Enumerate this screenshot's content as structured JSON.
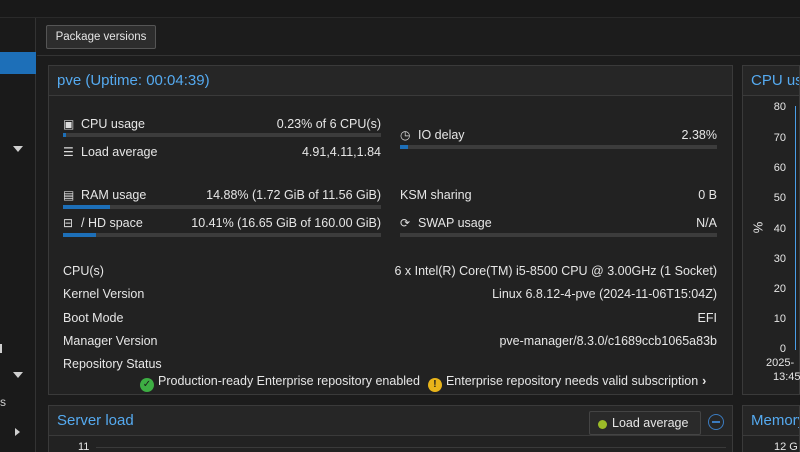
{
  "toolbar": {
    "package_versions_label": "Package versions"
  },
  "summary": {
    "title": "pve (Uptime: 00:04:39)",
    "cpu_usage": {
      "label": "CPU usage",
      "value": "0.23% of 6 CPU(s)",
      "fraction": 0.0023
    },
    "io_delay": {
      "label": "IO delay",
      "value": "2.38%",
      "fraction": 0.0238
    },
    "load_average": {
      "label": "Load average",
      "value": "4.91,4.11,1.84"
    },
    "ram_usage": {
      "label": "RAM usage",
      "value": "14.88% (1.72 GiB of 11.56 GiB)",
      "fraction": 0.1488
    },
    "ksm_sharing": {
      "label": "KSM sharing",
      "value": "0 B"
    },
    "hd_space": {
      "label": "/ HD space",
      "value": "10.41% (16.65 GiB of 160.00 GiB)",
      "fraction": 0.1041
    },
    "swap_usage": {
      "label": "SWAP usage",
      "value": "N/A",
      "fraction": 0
    },
    "info": [
      {
        "key": "CPU(s)",
        "value": "6 x Intel(R) Core(TM) i5-8500 CPU @ 3.00GHz (1 Socket)"
      },
      {
        "key": "Kernel Version",
        "value": "Linux 6.8.12-4-pve (2024-11-06T15:04Z)"
      },
      {
        "key": "Boot Mode",
        "value": "EFI"
      },
      {
        "key": "Manager Version",
        "value": "pve-manager/8.3.0/c1689ccb1065a83b"
      },
      {
        "key": "Repository Status",
        "value": ""
      }
    ],
    "repo_ok": "Production-ready Enterprise repository enabled",
    "repo_warn": "Enterprise repository needs valid subscription"
  },
  "cpu_chart": {
    "title": "CPU us",
    "y_unit": "%",
    "y_ticks": [
      "80",
      "70",
      "60",
      "50",
      "40",
      "30",
      "20",
      "10",
      "0"
    ],
    "x_tick_line1": "2025-",
    "x_tick_line2": "13:45"
  },
  "server_load": {
    "title": "Server load",
    "legend_label": "Load average",
    "y_top_tick": "11",
    "legend_color": "#9cbc28"
  },
  "memory_chart": {
    "title": "Memory",
    "y_top_tick": "12 G"
  },
  "colors": {
    "accent": "#55aaf0",
    "bar_fill": "#1d6fb8",
    "ok": "#3dae43",
    "warn": "#e8b41a"
  },
  "icons": [
    "cpu-chip-icon",
    "clock-icon",
    "tasks-icon",
    "memory-icon",
    "hdd-icon",
    "refresh-icon",
    "check-circle-icon",
    "exclamation-circle-icon",
    "chevron-right-icon"
  ]
}
